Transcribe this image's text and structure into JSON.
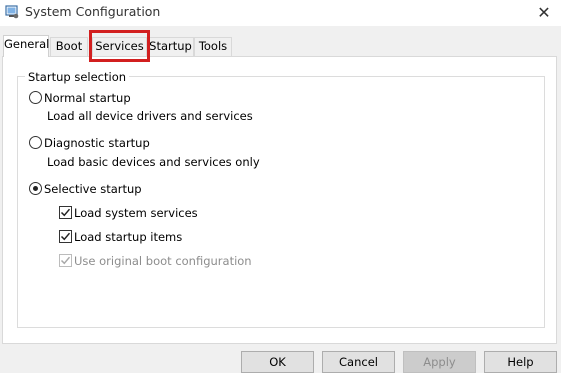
{
  "window": {
    "title": "System Configuration",
    "close_glyph": "✕"
  },
  "tabs": [
    {
      "label": "General",
      "active": true
    },
    {
      "label": "Boot",
      "active": false
    },
    {
      "label": "Services",
      "active": false,
      "highlighted": true
    },
    {
      "label": "Startup",
      "active": false
    },
    {
      "label": "Tools",
      "active": false
    }
  ],
  "startup_selection": {
    "group_label": "Startup selection",
    "normal": {
      "label": "Normal startup",
      "description": "Load all device drivers and services",
      "selected": false
    },
    "diagnostic": {
      "label": "Diagnostic startup",
      "description": "Load basic devices and services only",
      "selected": false
    },
    "selective": {
      "label": "Selective startup",
      "selected": true,
      "options": [
        {
          "label": "Load system services",
          "checked": true,
          "enabled": true
        },
        {
          "label": "Load startup items",
          "checked": true,
          "enabled": true
        },
        {
          "label": "Use original boot configuration",
          "checked": true,
          "enabled": false
        }
      ]
    }
  },
  "buttons": {
    "ok": "OK",
    "cancel": "Cancel",
    "apply": "Apply",
    "help": "Help"
  },
  "colors": {
    "highlight": "#d21f1f"
  }
}
